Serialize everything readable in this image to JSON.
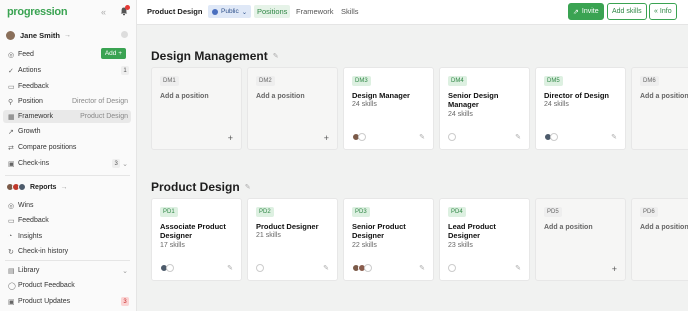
{
  "app": {
    "logo": "progression"
  },
  "sidebar": {
    "user": {
      "name": "Jane Smith"
    },
    "items": [
      {
        "label": "Feed",
        "action": "Add +"
      },
      {
        "label": "Actions",
        "count": "1"
      },
      {
        "label": "Feedback"
      },
      {
        "label": "Position",
        "value": "Director of Design"
      },
      {
        "label": "Framework",
        "value": "Product Design"
      },
      {
        "label": "Growth"
      },
      {
        "label": "Compare positions"
      },
      {
        "label": "Check-ins",
        "count": "3"
      }
    ],
    "reports": {
      "label": "Reports",
      "items": [
        {
          "label": "Wins"
        },
        {
          "label": "Feedback"
        },
        {
          "label": "Insights"
        },
        {
          "label": "Check-in history"
        }
      ]
    },
    "bottom": [
      {
        "label": "Library"
      },
      {
        "label": "Product Feedback"
      },
      {
        "label": "Product Updates",
        "count": "3"
      }
    ]
  },
  "topbar": {
    "title": "Product Design",
    "visibility": "Public",
    "tabs": [
      "Positions",
      "Framework",
      "Skills"
    ],
    "buttons": {
      "invite": "Invite",
      "add_skills": "Add skills",
      "info": "Info"
    }
  },
  "sections": [
    {
      "title": "Design Management",
      "cards": [
        {
          "code": "DM1",
          "title": "Add a position",
          "empty": true
        },
        {
          "code": "DM2",
          "title": "Add a position",
          "empty": true
        },
        {
          "code": "DM3",
          "title": "Design Manager",
          "skills": "24 skills"
        },
        {
          "code": "DM4",
          "title": "Senior Design Manager",
          "skills": "24 skills"
        },
        {
          "code": "DM5",
          "title": "Director of Design",
          "skills": "24 skills"
        },
        {
          "code": "DM6",
          "title": "Add a position",
          "empty": true
        }
      ]
    },
    {
      "title": "Product Design",
      "cards": [
        {
          "code": "PD1",
          "title": "Associate Product Designer",
          "skills": "17 skills"
        },
        {
          "code": "PD2",
          "title": "Product Designer",
          "skills": "21 skills"
        },
        {
          "code": "PD3",
          "title": "Senior Product Designer",
          "skills": "22 skills"
        },
        {
          "code": "PD4",
          "title": "Lead Product Designer",
          "skills": "23 skills"
        },
        {
          "code": "PD5",
          "title": "Add a position",
          "empty": true
        },
        {
          "code": "PD6",
          "title": "Add a position",
          "empty": true
        }
      ]
    }
  ],
  "colors": {
    "brand_green": "#3aa352",
    "alert_red": "#e53935",
    "public_blue": "#dfe8f7"
  },
  "icons": [
    "collapse-icon",
    "bell-icon",
    "plus-icon",
    "pencil-icon",
    "link-icon",
    "chevron-down-icon"
  ]
}
